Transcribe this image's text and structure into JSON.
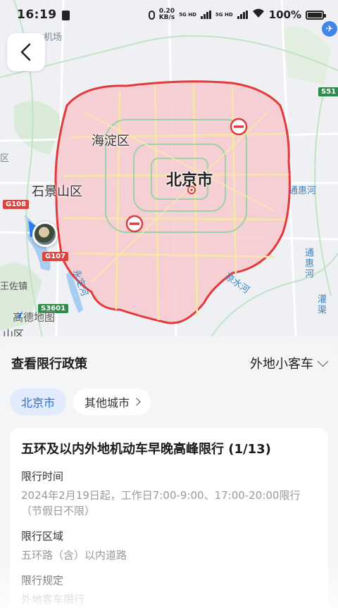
{
  "status_bar": {
    "time": "16:19",
    "net_speed_value": "0.20",
    "net_speed_unit": "KB/s",
    "sig1": "5G HD",
    "sig2": "5G HD",
    "battery": "100%"
  },
  "map": {
    "labels": {
      "city": "北京市",
      "haidian": "海淀区",
      "shijingshan": "石景山区",
      "tonghui_river": "通惠河",
      "tonghui_river_v": "通惠河",
      "guanqu": "灌渠",
      "liangshui_river": "凉水河",
      "yongding_river": "永定河",
      "wangzuo": "王佐镇",
      "airport_faint": "机场",
      "shan_faint": "山区",
      "qu_faint": "区"
    },
    "road_shields": {
      "g108": "G108",
      "g107": "G107",
      "s3601": "S3601",
      "s51": "S51"
    },
    "brand": "高德地图"
  },
  "sheet": {
    "title": "查看限行政策",
    "vehicle_type": "外地小客车",
    "tabs": {
      "active": "北京市",
      "other": "其他城市"
    },
    "policy": {
      "title": "五环及以内外地机动车早晚高峰限行 (1/13)",
      "time_label": "限行时间",
      "time_value": "2024年2月19日起，工作日7:00-9:00、17:00-20:00限行（节假日不限）",
      "area_label": "限行区域",
      "area_value": "五环路（含）以内道路",
      "rule_label": "限行规定",
      "rule_value": "外地客车限行"
    }
  },
  "colors": {
    "accent": "#1e6fe0",
    "restriction_zone_fill": "#f7c9cf",
    "restriction_zone_border": "#e23a3a"
  }
}
